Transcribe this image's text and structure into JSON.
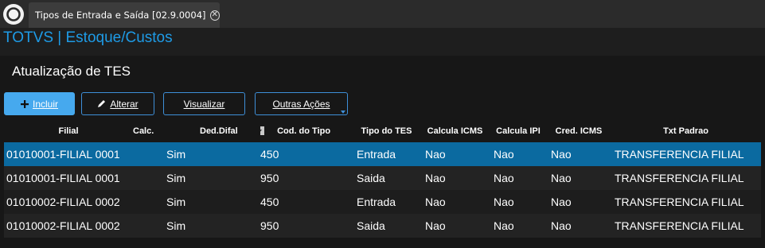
{
  "tab": {
    "title": "Tipos de Entrada e Saída [02.9.0004]",
    "close_glyph": "✕"
  },
  "module_title": "TOTVS | Estoque/Custos",
  "page_title": "Atualização de TES",
  "toolbar": {
    "incluir_label": "Incluir",
    "alterar_label": "Alterar",
    "visualizar_label": "Visualizar",
    "outras_acoes_label": "Outras Ações"
  },
  "icons": {
    "app_logo": "totvs-logo-icon",
    "incluir": "plus-icon",
    "alterar": "pencil-icon",
    "sort": "sort-dropdown-icon"
  },
  "colors": {
    "accent": "#1e9be6",
    "primary_button": "#46a9ee",
    "selected_row": "#0b6aa0"
  },
  "grid": {
    "columns": [
      "Filial",
      "Calc.",
      "Ded.Difal",
      "Cod. do Tipo",
      "Tipo do TES",
      "Calcula ICMS",
      "Calcula IPI",
      "Cred. ICMS",
      "Txt Padrao"
    ],
    "selected_row": 0,
    "rows": [
      [
        "01010001-FILIAL 0001",
        "Sim",
        "",
        "450",
        "Entrada",
        "Nao",
        "Nao",
        "Nao",
        "TRANSFERENCIA FILIAL"
      ],
      [
        "01010001-FILIAL 0001",
        "Sim",
        "",
        "950",
        "Saida",
        "Nao",
        "Nao",
        "Nao",
        "TRANSFERENCIA FILIAL"
      ],
      [
        "01010002-FILIAL 0002",
        "Sim",
        "",
        "450",
        "Entrada",
        "Nao",
        "Nao",
        "Nao",
        "TRANSFERENCIA FILIAL"
      ],
      [
        "01010002-FILIAL 0002",
        "Sim",
        "",
        "950",
        "Saida",
        "Nao",
        "Nao",
        "Nao",
        "TRANSFERENCIA FILIAL"
      ]
    ]
  }
}
